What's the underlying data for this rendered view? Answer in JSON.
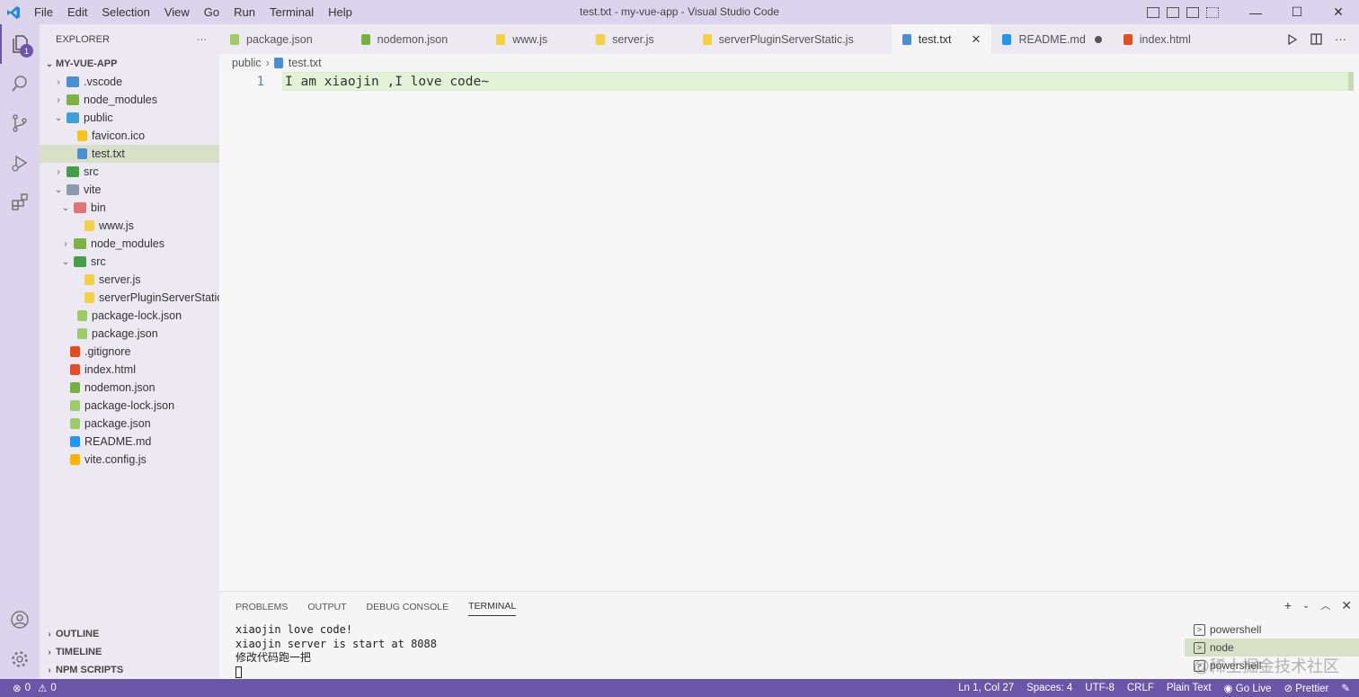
{
  "titlebar": {
    "title": "test.txt - my-vue-app - Visual Studio Code",
    "menu": [
      "File",
      "Edit",
      "Selection",
      "View",
      "Go",
      "Run",
      "Terminal",
      "Help"
    ]
  },
  "activity": {
    "explorer_badge": "1"
  },
  "sidebar": {
    "header": "EXPLORER",
    "more": "···",
    "root": "MY-VUE-APP",
    "tree": [
      {
        "label": ".vscode",
        "chev": "›",
        "indent": 0,
        "color": "#4a8fd6"
      },
      {
        "label": "node_modules",
        "chev": "›",
        "indent": 0,
        "color": "#7cb342"
      },
      {
        "label": "public",
        "chev": "⌄",
        "indent": 0,
        "color": "#3da0d8"
      },
      {
        "label": "favicon.ico",
        "chev": "",
        "indent": 1,
        "color": "#f5c518"
      },
      {
        "label": "test.txt",
        "chev": "",
        "indent": 1,
        "color": "#4a8fd6",
        "selected": true
      },
      {
        "label": "src",
        "chev": "›",
        "indent": 0,
        "color": "#43a047"
      },
      {
        "label": "vite",
        "chev": "⌄",
        "indent": 0,
        "color": "#8a9bb0"
      },
      {
        "label": "bin",
        "chev": "⌄",
        "indent": 1,
        "color": "#e57373"
      },
      {
        "label": "www.js",
        "chev": "",
        "indent": 2,
        "color": "#f5d142"
      },
      {
        "label": "node_modules",
        "chev": "›",
        "indent": 1,
        "color": "#7cb342"
      },
      {
        "label": "src",
        "chev": "⌄",
        "indent": 1,
        "color": "#43a047"
      },
      {
        "label": "server.js",
        "chev": "",
        "indent": 2,
        "color": "#f5d142"
      },
      {
        "label": "serverPluginServerStatic...",
        "chev": "",
        "indent": 2,
        "color": "#f5d142"
      },
      {
        "label": "package-lock.json",
        "chev": "",
        "indent": 1,
        "color": "#9ccc65"
      },
      {
        "label": "package.json",
        "chev": "",
        "indent": 1,
        "color": "#9ccc65"
      },
      {
        "label": ".gitignore",
        "chev": "",
        "indent": 0,
        "color": "#e64a19"
      },
      {
        "label": "index.html",
        "chev": "",
        "indent": 0,
        "color": "#e44d26"
      },
      {
        "label": "nodemon.json",
        "chev": "",
        "indent": 0,
        "color": "#76b041"
      },
      {
        "label": "package-lock.json",
        "chev": "",
        "indent": 0,
        "color": "#9ccc65"
      },
      {
        "label": "package.json",
        "chev": "",
        "indent": 0,
        "color": "#9ccc65"
      },
      {
        "label": "README.md",
        "chev": "",
        "indent": 0,
        "color": "#2196f3"
      },
      {
        "label": "vite.config.js",
        "chev": "",
        "indent": 0,
        "color": "#ffb300"
      }
    ],
    "sections": [
      "OUTLINE",
      "TIMELINE",
      "NPM SCRIPTS"
    ]
  },
  "tabs": [
    {
      "label": "package.json",
      "color": "#9ccc65"
    },
    {
      "label": "nodemon.json",
      "color": "#76b041"
    },
    {
      "label": "www.js",
      "color": "#f5d142"
    },
    {
      "label": "server.js",
      "color": "#f5d142"
    },
    {
      "label": "serverPluginServerStatic.js",
      "color": "#f5d142"
    },
    {
      "label": "test.txt",
      "color": "#4a8fd6",
      "active": true
    },
    {
      "label": "README.md",
      "color": "#2196f3",
      "dirty": true
    },
    {
      "label": "index.html",
      "color": "#e44d26"
    }
  ],
  "breadcrumb": {
    "folder": "public",
    "file": "test.txt"
  },
  "editor": {
    "line_number": "1",
    "line_text": "I am xiaojin ,I love code~"
  },
  "panel": {
    "tabs": [
      "PROBLEMS",
      "OUTPUT",
      "DEBUG CONSOLE",
      "TERMINAL"
    ],
    "terminal_lines": [
      "xiaojin love code!",
      "xiaojin server is start at 8088",
      "修改代码跑一把"
    ],
    "terminals": [
      {
        "label": "powershell",
        "active": false
      },
      {
        "label": "node",
        "active": true
      },
      {
        "label": "powershell",
        "active": false
      }
    ],
    "watermark": "@稀土掘金技术社区"
  },
  "status": {
    "errors": "0",
    "warnings": "0",
    "right": [
      "Ln 1, Col 27",
      "Spaces: 4",
      "UTF-8",
      "CRLF",
      "Plain Text",
      "Go Live",
      "Prettier"
    ]
  },
  "colors": {
    "accent": "#6a56a8",
    "titlebar": "#dcd3ed",
    "selection": "#d9e0c8"
  }
}
